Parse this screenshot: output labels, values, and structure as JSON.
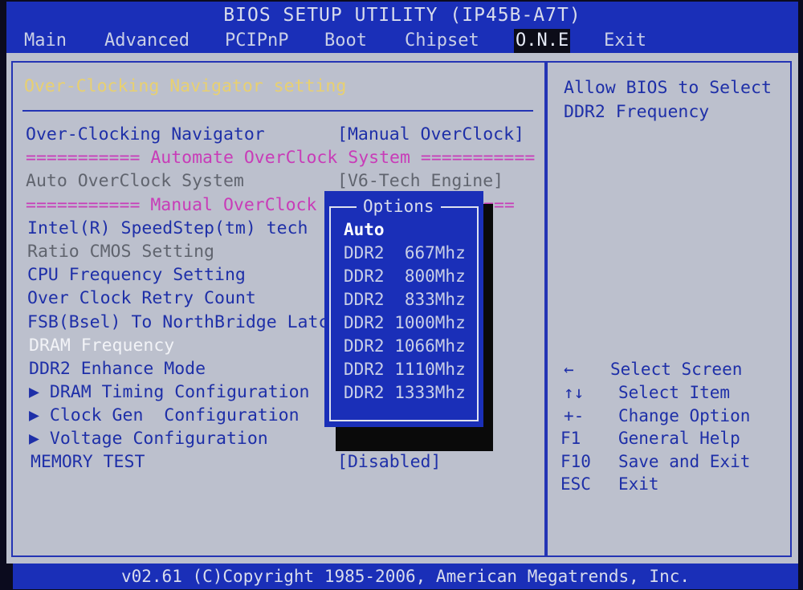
{
  "title": "BIOS SETUP UTILITY (IP45B-A7T)",
  "menu": [
    "Main",
    "Advanced",
    "PCIPnP",
    "Boot",
    "Chipset",
    "O.N.E",
    "Exit"
  ],
  "section_title": "Over-Clocking Navigator setting",
  "settings": [
    {
      "label": "Over-Clocking Navigator",
      "value": "[Manual OverClock]"
    },
    {
      "label": "=========== Automate OverClock System ==========="
    },
    {
      "label": "Auto OverClock System",
      "value": "[V6-Tech Engine]"
    },
    {
      "label": "=========== Manual OverClock",
      "suffix": "==="
    },
    {
      "label": "Intel(R) SpeedStep(tm) tech"
    },
    {
      "label": "Ratio CMOS Setting"
    },
    {
      "label": "CPU Frequency Setting"
    },
    {
      "label": "Over Clock Retry Count"
    },
    {
      "label": "FSB(Bsel) To NorthBridge Latch"
    },
    {
      "label": "DRAM Frequency"
    },
    {
      "label": "DDR2 Enhance Mode"
    },
    {
      "label": "▶ DRAM Timing Configuration"
    },
    {
      "label": "▶ Clock Gen  Configuration"
    },
    {
      "label": "▶ Voltage Configuration"
    },
    {
      "label": "MEMORY TEST",
      "value": "[Disabled]"
    }
  ],
  "popup": {
    "title": "Options",
    "options": [
      "Auto",
      "DDR2  667Mhz",
      "DDR2  800Mhz",
      "DDR2  833Mhz",
      "DDR2 1000Mhz",
      "DDR2 1066Mhz",
      "DDR2 1110Mhz",
      "DDR2 1333Mhz"
    ]
  },
  "help": {
    "line1": "Allow BIOS to Select",
    "line2": "DDR2 Frequency"
  },
  "keys": [
    {
      "key": "←",
      "action": "Select Screen"
    },
    {
      "key": "↑↓",
      "action": "Select Item"
    },
    {
      "key": "+-",
      "action": "Change Option"
    },
    {
      "key": "F1",
      "action": "General Help"
    },
    {
      "key": "F10",
      "action": "Save and Exit"
    },
    {
      "key": "ESC",
      "action": "Exit"
    }
  ],
  "footer": "v02.61 (C)Copyright 1985-2006, American Megatrends, Inc.",
  "colors": {
    "bar_blue": "#1a2fb8",
    "panel_gray": "#bcc0cd",
    "highlight_yellow": "#e8d070"
  }
}
